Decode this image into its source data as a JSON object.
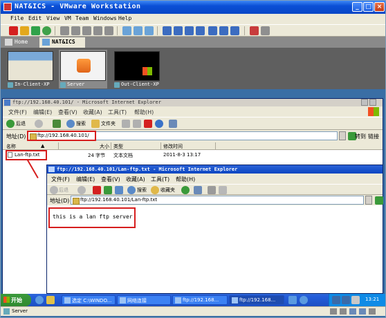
{
  "vmware": {
    "title": "NAT&ICS - VMware Workstation",
    "menu": [
      "File",
      "Edit",
      "View",
      "VM",
      "Team",
      "Windows",
      "Help"
    ],
    "tabs": [
      "Home",
      "NAT&ICS"
    ],
    "thumbnails": [
      "In-Client-XP",
      "Server",
      "Out-Client-XP"
    ],
    "status_text": "Server"
  },
  "ie_back": {
    "title": "ftp://192.168.40.101/ - Microsoft Internet Explorer",
    "menu": [
      "文件(F)",
      "编辑(E)",
      "查看(V)",
      "收藏(A)",
      "工具(T)",
      "帮助(H)"
    ],
    "toolbar": {
      "back": "后退",
      "search": "搜索",
      "folders": "文件夹"
    },
    "address_label": "地址(D)",
    "address": "ftp://192.168.40.101/",
    "go_label": "转到",
    "links_label": "链接",
    "columns": [
      "名称",
      "大小",
      "类型",
      "修改时间"
    ],
    "files": [
      {
        "name": "Lan-ftp.txt",
        "size": "24 字节",
        "type": "文本文档",
        "modified": "2011-8-3 13:17"
      }
    ]
  },
  "ie_front": {
    "title": "ftp://192.168.40.101/Lan-ftp.txt - Microsoft Internet Explorer",
    "menu": [
      "文件(F)",
      "编辑(E)",
      "查看(V)",
      "收藏(A)",
      "工具(T)",
      "帮助(H)"
    ],
    "toolbar": {
      "back": "后退",
      "search": "搜索",
      "favorites": "收藏夹"
    },
    "address_label": "地址(D)",
    "address": "ftp://192.168.40.101/Lan-ftp.txt",
    "body_text": "this is a lan ftp server"
  },
  "taskbar": {
    "start_label": "开始",
    "buttons": [
      "选定 C:\\WINDO...",
      "网络连接",
      "ftp://192.168...",
      "ftp://192.168..."
    ],
    "clock": "13:21"
  }
}
